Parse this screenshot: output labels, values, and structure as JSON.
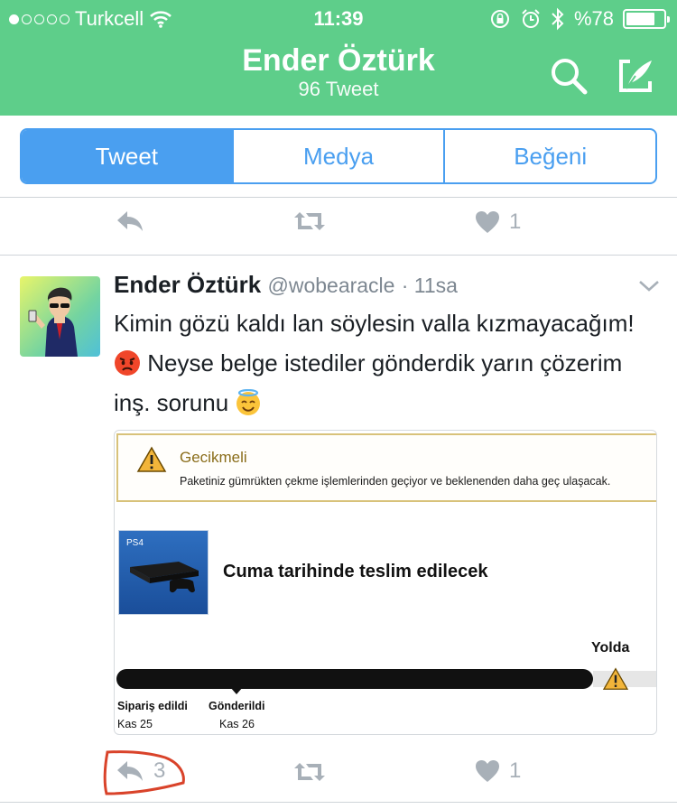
{
  "status_bar": {
    "carrier": "Turkcell",
    "time": "11:39",
    "battery_text": "%78",
    "battery_level": 0.78
  },
  "header": {
    "title": "Ender Öztürk",
    "subtitle": "96 Tweet",
    "icons": [
      "search-icon",
      "compose-icon"
    ],
    "background": "#5ece8a"
  },
  "tabs": [
    {
      "label": "Tweet",
      "active": true
    },
    {
      "label": "Medya",
      "active": false
    },
    {
      "label": "Beğeni",
      "active": false
    }
  ],
  "prev_tweet_actions": {
    "like_count": "1"
  },
  "tweet": {
    "name": "Ender Öztürk",
    "handle": "@wobearacle",
    "time": "· 11sa",
    "text_line1": "Kimin gözü kaldı lan söylesin valla kızmayacağım!",
    "text_line2": "Neyse belge istediler gönderdik yarın çözerim",
    "text_line3": "inş. sorunu",
    "emojis": [
      "angry-face-emoji",
      "smiling-face-with-halo-emoji"
    ],
    "media": {
      "delay_title": "Gecikmeli",
      "delay_text": "Paketiniz gümrükten çekme işlemlerinden geçiyor ve beklenenden daha geç ulaşacak.",
      "delivery_text": "Cuma tarihinde teslim edilecek",
      "status_label": "Yolda",
      "steps": [
        {
          "label": "Sipariş edildi",
          "date": "Kas 25"
        },
        {
          "label": "Gönderildi",
          "date": "Kas 26"
        }
      ]
    },
    "actions": {
      "reply_count": "3",
      "like_count": "1"
    }
  },
  "colors": {
    "accent": "#4a9ff0",
    "header_green": "#5ece8a",
    "action_gray": "#a8b0b8",
    "annotation_red": "#d9432a"
  }
}
